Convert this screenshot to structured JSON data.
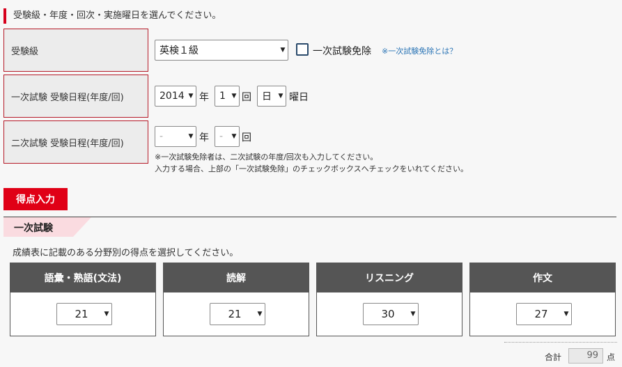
{
  "intro": "受験級・年度・回次・実施曜日を選んでください。",
  "rows": {
    "grade_label": "受験級",
    "first_label": "一次試験 受験日程(年度/回)",
    "second_label": "二次試験 受験日程(年度/回)"
  },
  "grade": {
    "selected": "英検１級",
    "exempt_label": "一次試験免除",
    "exempt_checked": false,
    "exempt_link": "※一次試験免除とは？"
  },
  "first": {
    "year": "2014",
    "year_unit": "年",
    "round": "1",
    "round_unit": "回",
    "day": "日",
    "day_unit": "曜日"
  },
  "second": {
    "year": "-",
    "year_unit": "年",
    "round": "-",
    "round_unit": "回",
    "note_line1": "※一次試験免除者は、二次試験の年度/回次も入力してください。",
    "note_line2": "入力する場合、上部の「一次試験免除」のチェックボックスへチェックをいれてください。"
  },
  "score": {
    "button_label": "得点入力",
    "section_title": "一次試験",
    "instruction": "成績表に記載のある分野別の得点を選択してください。",
    "columns": [
      {
        "label": "語彙・熟語(文法)",
        "value": "21"
      },
      {
        "label": "読解",
        "value": "21"
      },
      {
        "label": "リスニング",
        "value": "30"
      },
      {
        "label": "作文",
        "value": "27"
      }
    ],
    "total_label": "合計",
    "total_value": "99",
    "total_unit": "点"
  },
  "colors": {
    "accent_red": "#e00016",
    "label_border": "#b51a28",
    "column_header": "#555555",
    "pink_tab": "#fadbe0"
  },
  "icons": {
    "dropdown": "triangle-down-icon"
  }
}
